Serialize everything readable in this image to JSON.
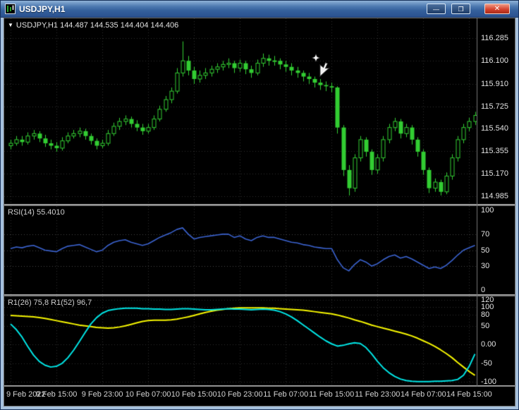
{
  "window": {
    "title": "USDJPY,H1",
    "controls": {
      "minimize": "—",
      "restore": "❐",
      "close": "✕"
    }
  },
  "panels": {
    "main_header": {
      "dropdown": "▼",
      "text": "USDJPY,H1 144.487 144.535 144.404 144.406"
    },
    "rsi_header": "RSI(14) 55.4010",
    "osc_header": "R1(26) 75,8  R1(52) 96,7"
  },
  "colors": {
    "background": "#000000",
    "grid": "#2e2e2e",
    "candle": "#32cd32",
    "rsi_line": "#3a62cf",
    "osc_fast": "#f5f500",
    "osc_slow": "#00e5e5"
  },
  "chart_data": [
    {
      "type": "candlestick",
      "symbol": "USDJPY",
      "timeframe": "H1",
      "color": "#32cd32",
      "ylim": [
        114.92,
        116.45
      ],
      "y_axis": [
        "116.285",
        "116.100",
        "115.910",
        "115.725",
        "115.540",
        "115.355",
        "115.170",
        "114.985"
      ],
      "x_labels": [
        "9 Feb 2022",
        "9 Feb 15:00",
        "9 Feb 23:00",
        "10 Feb 07:00",
        "10 Feb 15:00",
        "10 Feb 23:00",
        "11 Feb 07:00",
        "11 Feb 15:00",
        "11 Feb 23:00",
        "14 Feb 07:00",
        "14 Feb 15:00"
      ],
      "candles": [
        [
          115.4,
          115.45,
          115.37,
          115.42
        ],
        [
          115.42,
          115.48,
          115.4,
          115.45
        ],
        [
          115.45,
          115.48,
          115.4,
          115.43
        ],
        [
          115.43,
          115.51,
          115.41,
          115.48
        ],
        [
          115.48,
          115.53,
          115.45,
          115.5
        ],
        [
          115.5,
          115.52,
          115.43,
          115.46
        ],
        [
          115.46,
          115.49,
          115.39,
          115.42
        ],
        [
          115.42,
          115.45,
          115.37,
          115.4
        ],
        [
          115.4,
          115.43,
          115.35,
          115.38
        ],
        [
          115.38,
          115.47,
          115.36,
          115.44
        ],
        [
          115.44,
          115.51,
          115.42,
          115.48
        ],
        [
          115.48,
          115.53,
          115.46,
          115.5
        ],
        [
          115.5,
          115.55,
          115.47,
          115.52
        ],
        [
          115.52,
          115.54,
          115.45,
          115.48
        ],
        [
          115.48,
          115.5,
          115.41,
          115.44
        ],
        [
          115.44,
          115.46,
          115.37,
          115.4
        ],
        [
          115.4,
          115.45,
          115.38,
          115.42
        ],
        [
          115.42,
          115.53,
          115.4,
          115.5
        ],
        [
          115.5,
          115.59,
          115.48,
          115.56
        ],
        [
          115.56,
          115.63,
          115.53,
          115.6
        ],
        [
          115.6,
          115.65,
          115.57,
          115.62
        ],
        [
          115.62,
          115.64,
          115.55,
          115.58
        ],
        [
          115.58,
          115.61,
          115.52,
          115.55
        ],
        [
          115.55,
          115.58,
          115.49,
          115.52
        ],
        [
          115.52,
          115.58,
          115.5,
          115.55
        ],
        [
          115.55,
          115.65,
          115.53,
          115.62
        ],
        [
          115.62,
          115.73,
          115.6,
          115.7
        ],
        [
          115.7,
          115.81,
          115.68,
          115.78
        ],
        [
          115.78,
          115.88,
          115.75,
          115.85
        ],
        [
          115.85,
          116.04,
          115.83,
          116.0
        ],
        [
          116.0,
          116.26,
          115.97,
          116.1
        ],
        [
          116.1,
          116.14,
          115.98,
          116.02
        ],
        [
          116.02,
          116.05,
          115.91,
          115.95
        ],
        [
          115.95,
          116.02,
          115.92,
          115.98
        ],
        [
          115.98,
          116.04,
          115.95,
          116.0
        ],
        [
          116.0,
          116.06,
          115.97,
          116.03
        ],
        [
          116.03,
          116.08,
          116.0,
          116.05
        ],
        [
          116.05,
          116.1,
          116.02,
          116.07
        ],
        [
          116.07,
          116.12,
          116.04,
          116.08
        ],
        [
          116.08,
          116.1,
          116.0,
          116.04
        ],
        [
          116.04,
          116.11,
          116.01,
          116.08
        ],
        [
          116.08,
          116.1,
          115.99,
          116.03
        ],
        [
          116.03,
          116.06,
          115.96,
          116.0
        ],
        [
          116.0,
          116.11,
          115.98,
          116.08
        ],
        [
          116.08,
          116.16,
          116.05,
          116.12
        ],
        [
          116.12,
          116.15,
          116.06,
          116.1
        ],
        [
          116.1,
          116.14,
          116.06,
          116.1
        ],
        [
          116.1,
          116.12,
          116.03,
          116.07
        ],
        [
          116.07,
          116.1,
          116.01,
          116.05
        ],
        [
          116.05,
          116.08,
          115.98,
          116.02
        ],
        [
          116.02,
          116.05,
          115.96,
          116.0
        ],
        [
          116.0,
          116.02,
          115.93,
          115.97
        ],
        [
          115.97,
          116.0,
          115.91,
          115.95
        ],
        [
          115.95,
          115.97,
          115.88,
          115.92
        ],
        [
          115.92,
          115.95,
          115.86,
          115.9
        ],
        [
          115.9,
          115.93,
          115.85,
          115.89
        ],
        [
          115.89,
          115.92,
          115.84,
          115.88
        ],
        [
          115.88,
          115.89,
          115.5,
          115.55
        ],
        [
          115.55,
          115.57,
          115.15,
          115.2
        ],
        [
          115.2,
          115.24,
          114.99,
          115.05
        ],
        [
          115.05,
          115.33,
          115.02,
          115.3
        ],
        [
          115.3,
          115.48,
          115.27,
          115.45
        ],
        [
          115.45,
          115.47,
          115.31,
          115.35
        ],
        [
          115.35,
          115.37,
          115.16,
          115.2
        ],
        [
          115.2,
          115.33,
          115.17,
          115.3
        ],
        [
          115.3,
          115.48,
          115.27,
          115.45
        ],
        [
          115.45,
          115.58,
          115.42,
          115.55
        ],
        [
          115.55,
          115.63,
          115.52,
          115.6
        ],
        [
          115.6,
          115.62,
          115.46,
          115.5
        ],
        [
          115.5,
          115.58,
          115.47,
          115.55
        ],
        [
          115.55,
          115.57,
          115.41,
          115.45
        ],
        [
          115.45,
          115.47,
          115.31,
          115.35
        ],
        [
          115.35,
          115.37,
          115.16,
          115.2
        ],
        [
          115.2,
          115.22,
          115.01,
          115.05
        ],
        [
          115.05,
          115.13,
          115.02,
          115.1
        ],
        [
          115.1,
          115.12,
          114.99,
          115.02
        ],
        [
          115.02,
          115.18,
          115.0,
          115.15
        ],
        [
          115.15,
          115.33,
          115.12,
          115.3
        ],
        [
          115.3,
          115.48,
          115.27,
          115.45
        ],
        [
          115.45,
          115.58,
          115.42,
          115.55
        ],
        [
          115.55,
          115.63,
          115.52,
          115.6
        ],
        [
          115.6,
          115.68,
          115.57,
          115.65
        ]
      ]
    },
    {
      "type": "line",
      "name": "RSI(14)",
      "value": "55.4010",
      "color": "#3a62cf",
      "ylim": [
        0,
        100
      ],
      "y_axis": [
        "100",
        "70",
        "50",
        "30",
        "0"
      ],
      "levels": [
        70,
        50,
        30
      ],
      "values": [
        52,
        54,
        53,
        55,
        56,
        53,
        50,
        49,
        48,
        52,
        55,
        56,
        57,
        54,
        51,
        48,
        50,
        56,
        60,
        62,
        63,
        60,
        58,
        56,
        58,
        62,
        66,
        69,
        72,
        76,
        78,
        70,
        64,
        66,
        67,
        68,
        69,
        70,
        70,
        66,
        68,
        64,
        62,
        66,
        68,
        66,
        66,
        64,
        62,
        60,
        59,
        57,
        56,
        54,
        53,
        52,
        52,
        38,
        28,
        24,
        32,
        38,
        35,
        30,
        33,
        38,
        42,
        44,
        40,
        42,
        39,
        35,
        31,
        27,
        29,
        27,
        31,
        37,
        44,
        50,
        53,
        56
      ]
    },
    {
      "type": "line",
      "name": "oscillator",
      "ylim": [
        -105,
        125
      ],
      "y_axis": [
        "120",
        "100",
        "80",
        "50",
        "0.00",
        "-50",
        "-100"
      ],
      "series": [
        {
          "name": "R1(26)",
          "value": "75,8",
          "color": "#f5f500",
          "values": [
            78,
            77,
            76,
            75,
            74,
            72,
            70,
            67,
            64,
            61,
            58,
            55,
            52,
            50,
            48,
            46,
            45,
            44,
            45,
            47,
            50,
            54,
            58,
            62,
            64,
            65,
            65,
            65,
            66,
            68,
            71,
            74,
            78,
            82,
            86,
            89,
            92,
            94,
            96,
            97,
            98,
            98,
            98,
            98,
            98,
            97,
            97,
            96,
            95,
            94,
            93,
            92,
            90,
            88,
            86,
            84,
            82,
            79,
            75,
            71,
            66,
            62,
            57,
            52,
            48,
            44,
            40,
            36,
            32,
            28,
            23,
            17,
            10,
            3,
            -5,
            -14,
            -24,
            -35,
            -48,
            -60,
            -72,
            -82
          ]
        },
        {
          "name": "R1(52)",
          "value": "96,7",
          "color": "#00e5e5",
          "values": [
            55,
            40,
            20,
            -5,
            -28,
            -45,
            -55,
            -60,
            -58,
            -50,
            -35,
            -15,
            8,
            32,
            55,
            72,
            84,
            91,
            94,
            96,
            97,
            97,
            97,
            96,
            96,
            95,
            95,
            94,
            94,
            95,
            96,
            96,
            95,
            94,
            93,
            93,
            94,
            95,
            96,
            95,
            95,
            94,
            93,
            94,
            95,
            94,
            92,
            88,
            82,
            74,
            64,
            53,
            42,
            31,
            20,
            10,
            2,
            -4,
            -2,
            2,
            5,
            3,
            -8,
            -25,
            -45,
            -62,
            -75,
            -85,
            -92,
            -96,
            -98,
            -99,
            -99,
            -99,
            -98,
            -98,
            -97,
            -96,
            -93,
            -82,
            -58,
            -25
          ]
        }
      ]
    }
  ]
}
